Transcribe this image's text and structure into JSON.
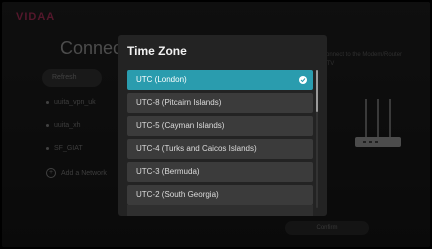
{
  "brand": {
    "logo_text": "VIDAA",
    "logo_color": "#9a2a4f"
  },
  "background": {
    "title": "Connect to a Network",
    "refresh_label": "Refresh",
    "networks": [
      "uuita_vpn_uk",
      "uuita_xh",
      "SF_GIAT"
    ],
    "add_network_label": "Add a Network",
    "hint_text": "...connect to the Modem/Router for TV",
    "confirm_label": "Confirm"
  },
  "dialog": {
    "title": "Time Zone",
    "items": [
      {
        "label": "UTC (London)",
        "selected": true
      },
      {
        "label": "UTC-8 (Pitcairn Islands)",
        "selected": false
      },
      {
        "label": "UTC-5 (Cayman Islands)",
        "selected": false
      },
      {
        "label": "UTC-4 (Turks and Caicos Islands)",
        "selected": false
      },
      {
        "label": "UTC-3 (Bermuda)",
        "selected": false
      },
      {
        "label": "UTC-2 (South Georgia)",
        "selected": false
      }
    ],
    "accent_color": "#2a9cae",
    "icons": {
      "selected": "check-circle-icon"
    }
  }
}
